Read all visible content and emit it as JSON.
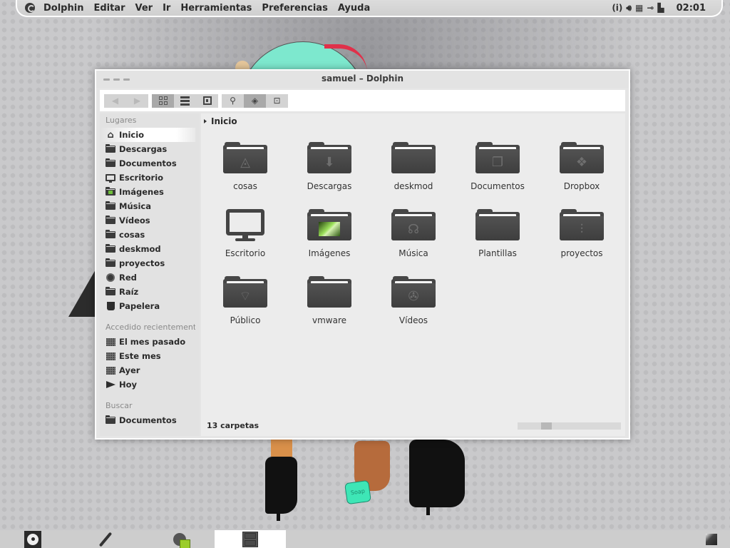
{
  "top_panel": {
    "app_icon": "dolphin-app-icon",
    "menu": [
      "Dolphin",
      "Editar",
      "Ver",
      "Ir",
      "Herramientas",
      "Preferencias",
      "Ayuda"
    ],
    "tray": {
      "info": "(i)",
      "icons": [
        "volume-icon",
        "calendar-icon",
        "network-icon",
        "battery-icon"
      ],
      "clock": "02:01"
    }
  },
  "window": {
    "title": "samuel – Dolphin",
    "toolbar": {
      "nav": [
        {
          "name": "back-button",
          "glyph": "◀"
        },
        {
          "name": "forward-button",
          "glyph": "▶"
        }
      ],
      "view_modes": [
        {
          "name": "icons-view-button",
          "active": true
        },
        {
          "name": "details-view-button",
          "active": false
        },
        {
          "name": "compact-view-button",
          "active": false
        }
      ],
      "tools": [
        {
          "name": "search-button",
          "glyph": "🔍",
          "active": false
        },
        {
          "name": "preview-button",
          "glyph": "◈",
          "active": true
        },
        {
          "name": "split-button",
          "glyph": "⊡",
          "active": false
        }
      ]
    },
    "sidebar": {
      "places_heading": "Lugares",
      "places": [
        {
          "label": "Inicio",
          "icon": "home-icon",
          "selected": true
        },
        {
          "label": "Descargas",
          "icon": "folder-icon"
        },
        {
          "label": "Documentos",
          "icon": "folder-icon"
        },
        {
          "label": "Escritorio",
          "icon": "monitor-icon"
        },
        {
          "label": "Imágenes",
          "icon": "image-folder-icon"
        },
        {
          "label": "Música",
          "icon": "folder-icon"
        },
        {
          "label": "Vídeos",
          "icon": "folder-icon"
        },
        {
          "label": "cosas",
          "icon": "folder-icon"
        },
        {
          "label": "deskmod",
          "icon": "folder-icon"
        },
        {
          "label": "proyectos",
          "icon": "folder-icon"
        },
        {
          "label": "Red",
          "icon": "network-globe-icon"
        },
        {
          "label": "Raíz",
          "icon": "folder-icon"
        },
        {
          "label": "Papelera",
          "icon": "trash-icon"
        }
      ],
      "recent_heading": "Accedido recientemente",
      "recent": [
        {
          "label": "El mes pasado",
          "icon": "calendar-icon"
        },
        {
          "label": "Este mes",
          "icon": "calendar-icon"
        },
        {
          "label": "Ayer",
          "icon": "calendar-list-icon"
        },
        {
          "label": "Hoy",
          "icon": "flag-icon"
        }
      ],
      "search_heading": "Buscar",
      "search": [
        {
          "label": "Documentos",
          "icon": "folder-icon"
        }
      ]
    },
    "content": {
      "breadcrumb": "Inicio",
      "items": [
        {
          "label": "cosas",
          "type": "folder",
          "emblem": "compass-icon"
        },
        {
          "label": "Descargas",
          "type": "folder",
          "emblem": "download-arrow-icon"
        },
        {
          "label": "deskmod",
          "type": "folder",
          "emblem": ""
        },
        {
          "label": "Documentos",
          "type": "folder",
          "emblem": "documents-icon"
        },
        {
          "label": "Dropbox",
          "type": "folder",
          "emblem": "dropbox-icon"
        },
        {
          "label": "Escritorio",
          "type": "monitor",
          "emblem": ""
        },
        {
          "label": "Imágenes",
          "type": "folder",
          "emblem": "photo-icon"
        },
        {
          "label": "Música",
          "type": "folder",
          "emblem": "headphones-icon"
        },
        {
          "label": "Plantillas",
          "type": "folder",
          "emblem": ""
        },
        {
          "label": "proyectos",
          "type": "folder",
          "emblem": "sliders-icon"
        },
        {
          "label": "Público",
          "type": "folder",
          "emblem": "wifi-icon"
        },
        {
          "label": "vmware",
          "type": "folder",
          "emblem": ""
        },
        {
          "label": "Vídeos",
          "type": "folder",
          "emblem": "film-reel-icon"
        }
      ],
      "status": "13 carpetas",
      "scroll_position": 0.25
    }
  },
  "taskbar": {
    "items": [
      {
        "name": "disc-launcher"
      },
      {
        "name": "pen-launcher"
      },
      {
        "name": "browser-launcher"
      },
      {
        "name": "file-manager-task",
        "active": true
      }
    ],
    "user": "user-avatar"
  }
}
